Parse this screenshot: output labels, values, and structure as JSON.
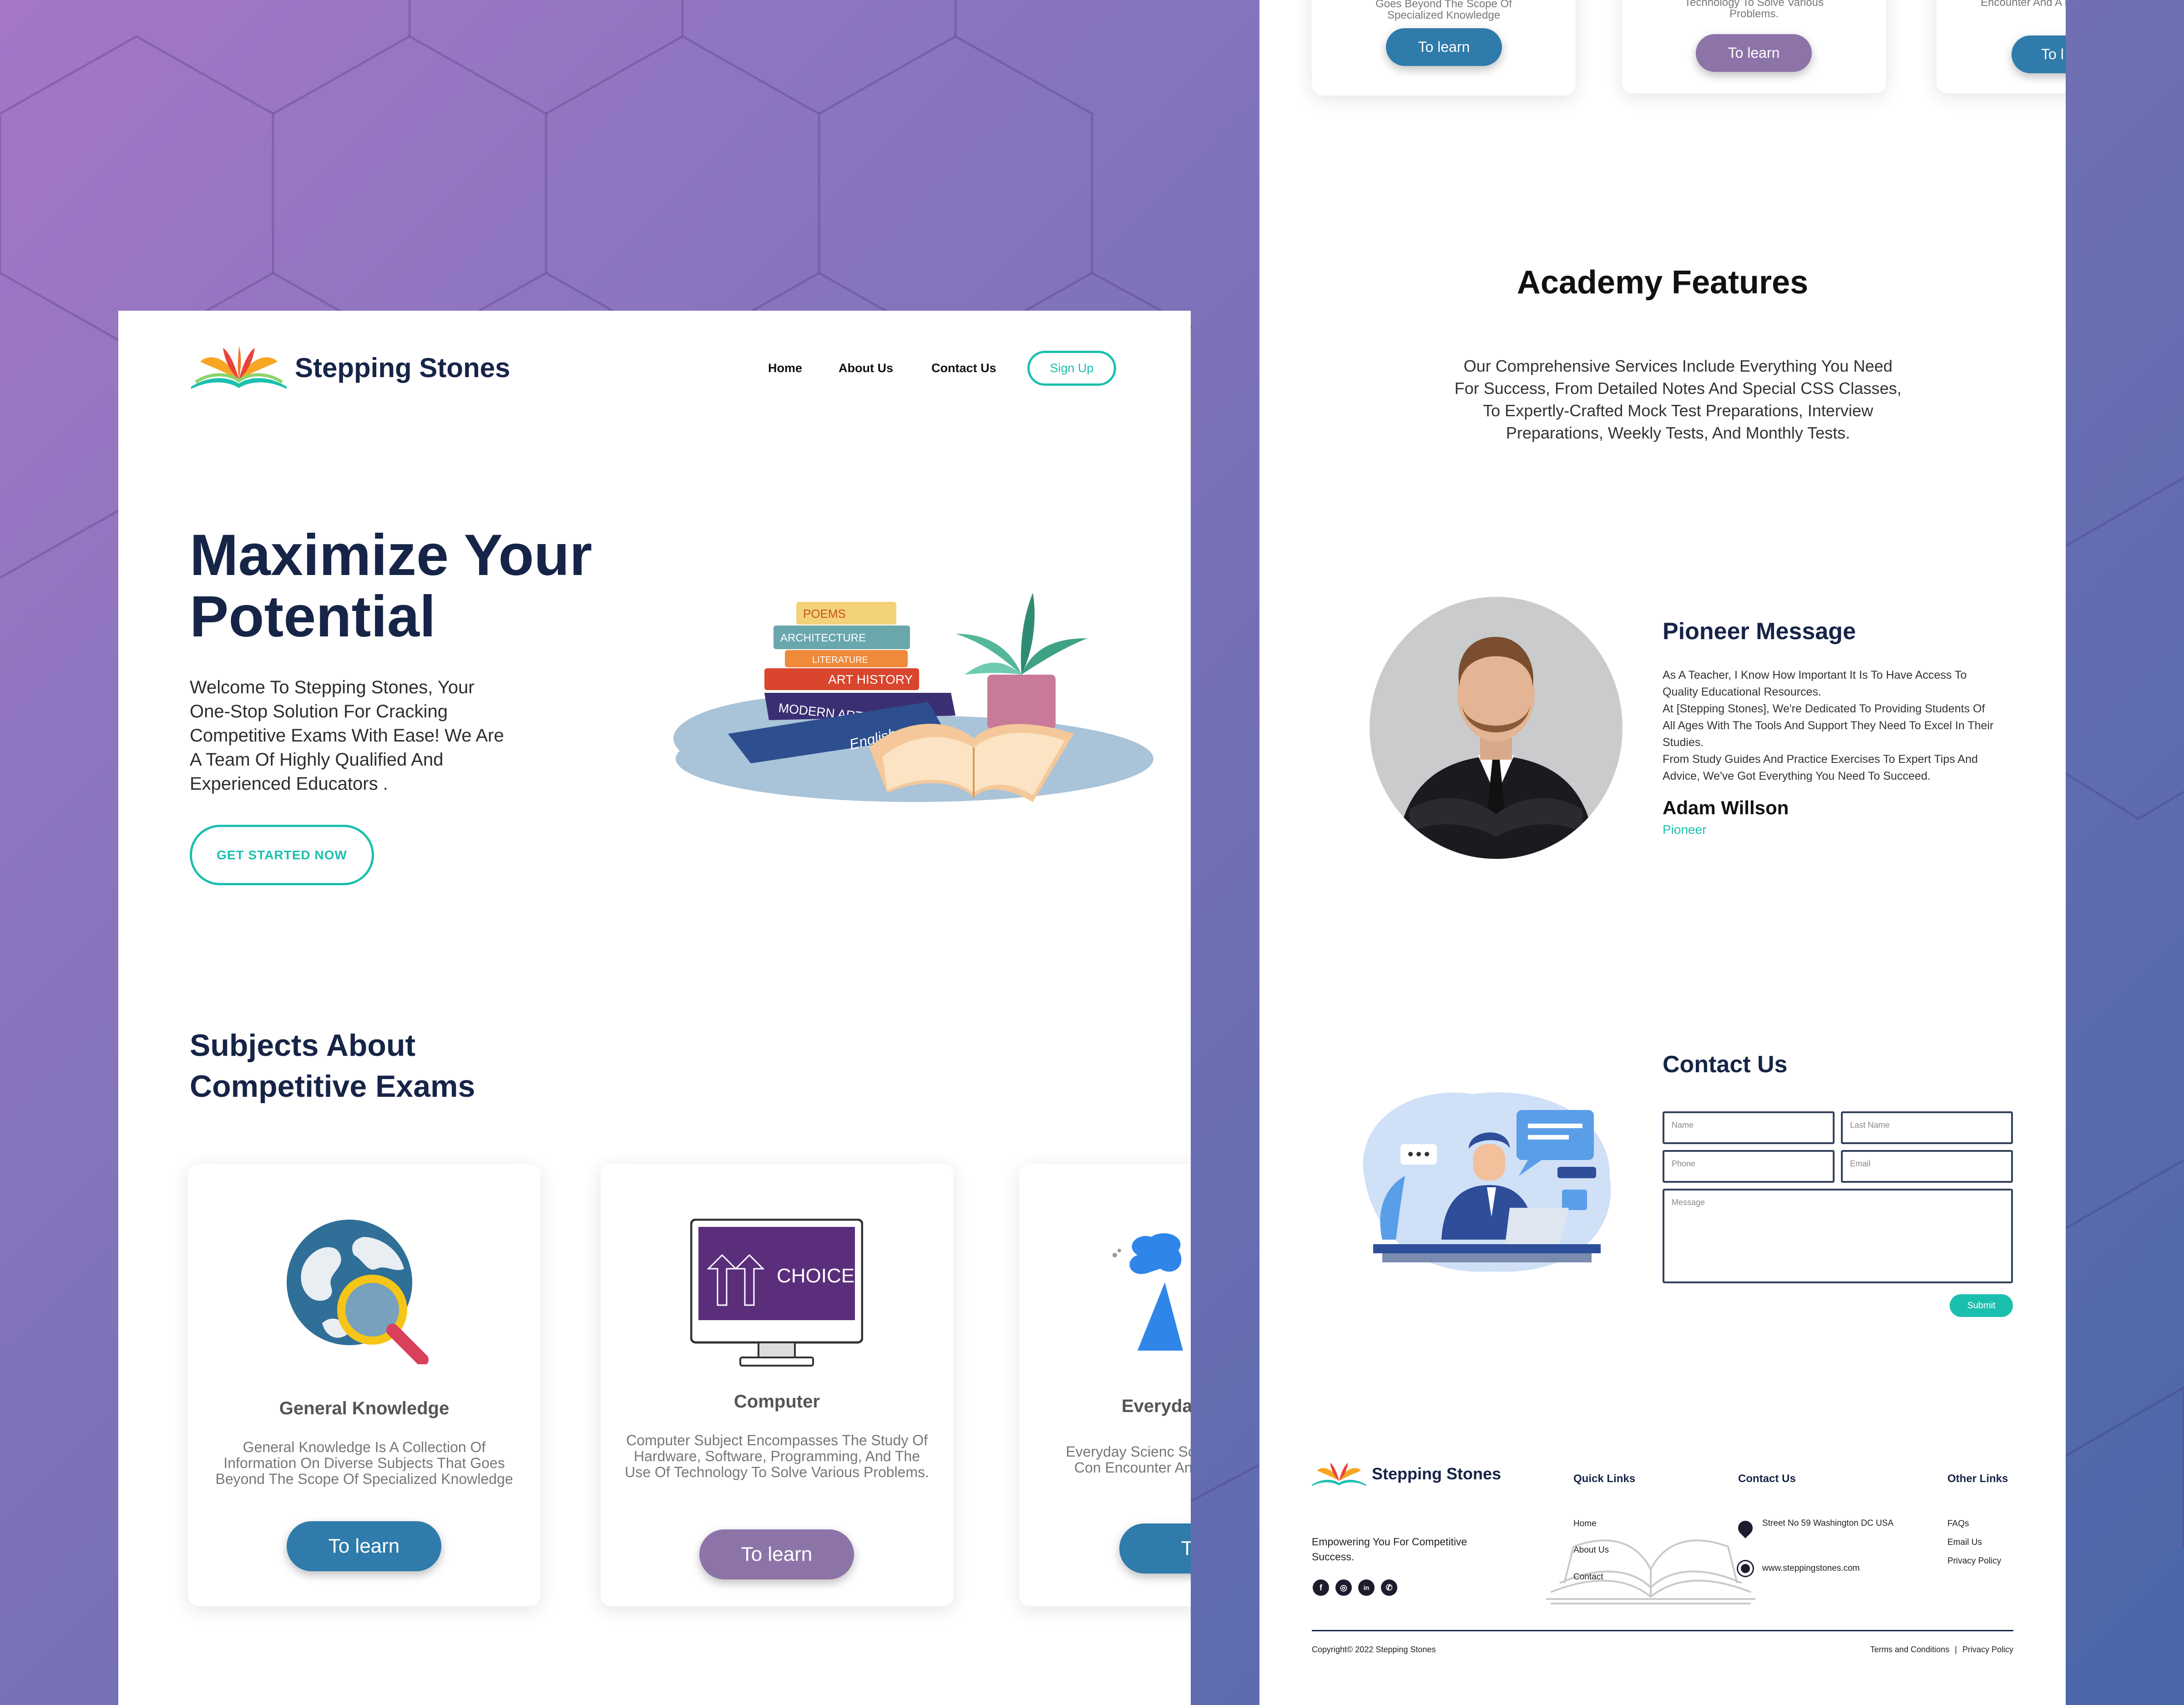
{
  "brand": {
    "name": "Stepping Stones"
  },
  "nav": {
    "home": "Home",
    "about": "About Us",
    "contact": "Contact Us",
    "signup": "Sign Up"
  },
  "hero": {
    "title_line1": "Maximize Your",
    "title_line2": "Potential",
    "text": "Welcome To Stepping Stones, Your One-Stop Solution For Cracking Competitive Exams With Ease! We Are A Team Of Highly Qualified And Experienced Educators .",
    "cta": "GET STARTED NOW",
    "book_labels": [
      "POEMS",
      "ARCHITECTURE",
      "LITERATURE",
      "ART HISTORY",
      "MODERN ART",
      "English"
    ]
  },
  "subjects": {
    "title_line1": "Subjects About",
    "title_line2": "Competitive Exams",
    "cards": [
      {
        "title": "General Knowledge",
        "desc": "General Knowledge Is A Collection Of Information On Diverse Subjects That Goes Beyond The Scope Of Specialized Knowledge",
        "button": "To learn"
      },
      {
        "title": "Computer",
        "desc": "Computer Subject Encompasses The Study Of Hardware, Software, Programming, And The Use Of Technology To Solve Various Problems.",
        "button": "To learn",
        "screen_text": "CHOICE"
      },
      {
        "title": "Everyda",
        "desc": "Everyday Scienc Scientific Con Encounter And A Li",
        "button": "To l"
      }
    ]
  },
  "top_cards": [
    {
      "desc_tail": "Goes Beyond The Scope Of Specialized Knowledge",
      "button": "To learn"
    },
    {
      "desc_tail": "Technology To Solve Various Problems.",
      "button": "To learn"
    },
    {
      "desc_tail": "Encounter And A Li",
      "button": "To l"
    }
  ],
  "features": {
    "title": "Academy Features",
    "text": "Our Comprehensive Services Include Everything You Need For Success, From Detailed Notes And Special CSS Classes, To Expertly-Crafted Mock Test Preparations, Interview Preparations, Weekly Tests, And Monthly Tests."
  },
  "pioneer": {
    "title": "Pioneer Message",
    "p1": "As A Teacher, I Know How Important It Is To Have Access To Quality Educational Resources.",
    "p2": "At [Stepping Stones], We're Dedicated To Providing Students Of All Ages With The Tools And Support They Need To Excel In Their Studies.",
    "p3": "From Study Guides And Practice Exercises To Expert Tips And Advice, We've Got Everything You Need To Succeed.",
    "name": "Adam Willson",
    "role": "Pioneer"
  },
  "contact": {
    "title": "Contact Us",
    "name_ph": "Name",
    "last_ph": "Last Name",
    "phone_ph": "Phone",
    "email_ph": "Email",
    "message_ph": "Message",
    "submit": "Submit"
  },
  "footer": {
    "tagline": "Empowering You For Competitive Success.",
    "quick_title": "Quick Links",
    "quick": [
      "Home",
      "About Us",
      "Contact"
    ],
    "contact_title": "Contact Us",
    "address": "Street No 59 Washington DC USA",
    "website": "www.steppingstones.com",
    "other_title": "Other Links",
    "other": [
      "FAQs",
      "Email Us",
      "Privacy Policy"
    ],
    "copyright": "Copyright© 2022 Stepping Stones",
    "terms": "Terms and Conditions",
    "sep": "|",
    "privacy": "Privacy Policy",
    "social": [
      "f",
      "◎",
      "in",
      "✆"
    ]
  },
  "colors": {
    "teal": "#1bbfae",
    "navy": "#162447",
    "blue_btn": "#2f7bab",
    "purple_btn": "#8d74a8"
  }
}
